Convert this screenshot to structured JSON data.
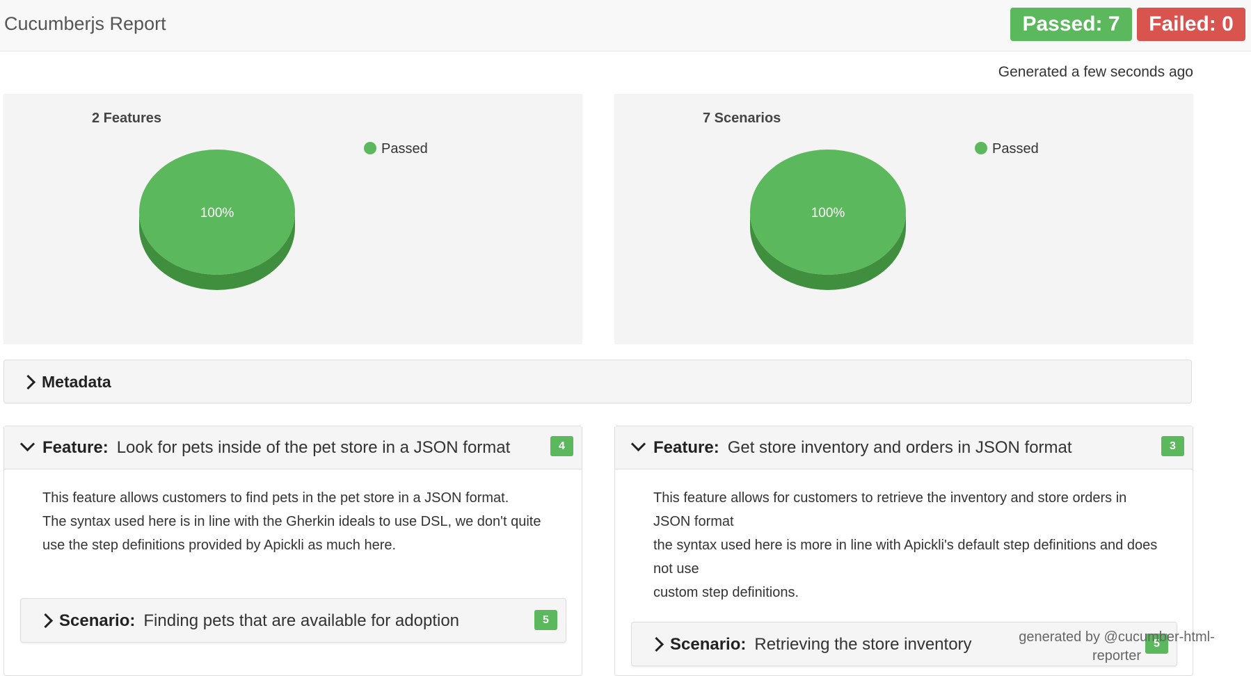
{
  "header": {
    "brand": "Cucumberjs Report",
    "passed": "Passed: 7",
    "failed": "Failed: 0"
  },
  "generated": "Generated a few seconds ago",
  "colors": {
    "passed": "#5cb85c",
    "failed": "#d9534f",
    "pie_top": "#5cb85c",
    "pie_side": "#3f8f3f"
  },
  "chart_data": [
    {
      "type": "pie",
      "title": "2 Features",
      "legend": [
        "Passed"
      ],
      "legend_placement": "top-right",
      "slices": [
        {
          "name": "Passed",
          "value": 100,
          "label": "100%"
        }
      ]
    },
    {
      "type": "pie",
      "title": "7 Scenarios",
      "legend": [
        "Passed"
      ],
      "legend_placement": "top-right",
      "slices": [
        {
          "name": "Passed",
          "value": 100,
          "label": "100%"
        }
      ]
    }
  ],
  "metadata": {
    "label": "Metadata"
  },
  "features": [
    {
      "keyword": "Feature:",
      "name": "Look for pets inside of the pet store in a JSON format",
      "count": "4",
      "description": [
        "This feature allows customers to find pets in the pet store in a JSON format.",
        "The syntax used here is in line with the Gherkin ideals to use DSL, we don't quite",
        "use the step definitions provided by Apickli as much here."
      ],
      "scenario": {
        "keyword": "Scenario:",
        "name": "Finding pets that are available for adoption",
        "count": "5"
      }
    },
    {
      "keyword": "Feature:",
      "name": "Get store inventory and orders in JSON format",
      "count": "3",
      "description": [
        "This feature allows for customers to retrieve the inventory and store orders in JSON format",
        "the syntax used here is more in line with Apickli's default step definitions and does not use",
        "custom step definitions."
      ],
      "scenario": {
        "keyword": "Scenario:",
        "name": "Retrieving the store inventory",
        "count": "5"
      }
    }
  ],
  "footer": {
    "text": "generated by @cucumber-html-reporter"
  }
}
